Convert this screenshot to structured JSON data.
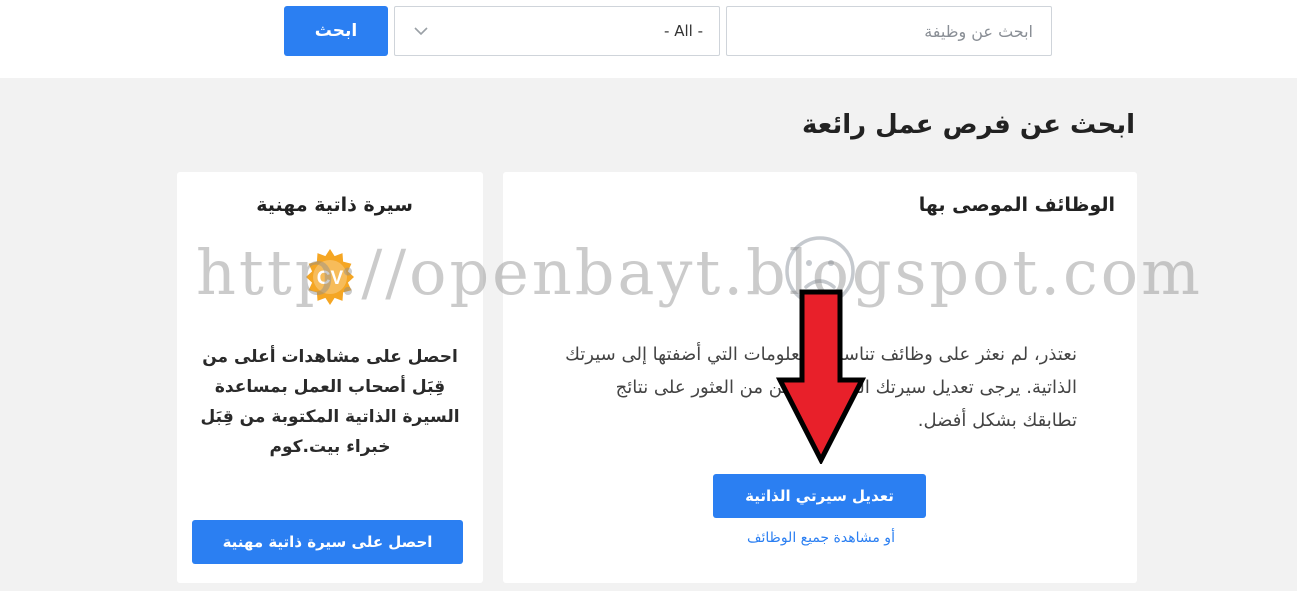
{
  "search": {
    "placeholder": "ابحث عن وظيفة",
    "select_value": "- All -",
    "button_label": "ابحث"
  },
  "page_heading": "ابحث عن فرص عمل رائعة",
  "cv_card": {
    "title": "سيرة ذاتية مهنية",
    "badge_text": "CV",
    "description": "احصل على مشاهدات أعلى من قِبَل أصحاب العمل بمساعدة السيرة الذاتية المكتوبة من قِبَل خبراء بيت.كوم",
    "button_label": "احصل على سيرة ذاتية مهنية"
  },
  "recommended_card": {
    "title": "الوظائف الموصى بها",
    "message": "نعتذر، لم نعثر على وظائف تناسب المعلومات التي أضفتها إلى سيرتك الذاتية. يرجى تعديل سيرتك الذاتية لتتمكن من العثور على نتائج تطابقك بشكل أفضل.",
    "edit_button_label": "تعديل سيرتي الذاتية",
    "all_jobs_link": "أو مشاهدة جميع الوظائف"
  },
  "watermark": "http://openbayt.blogspot.com",
  "colors": {
    "primary": "#2b7ff2",
    "badge": "#f5a623",
    "arrow": "#e8202a",
    "background": "#f2f2f2"
  },
  "icons": [
    "chevron-down-icon",
    "cv-badge-icon",
    "sad-face-icon",
    "red-arrow-annotation"
  ]
}
